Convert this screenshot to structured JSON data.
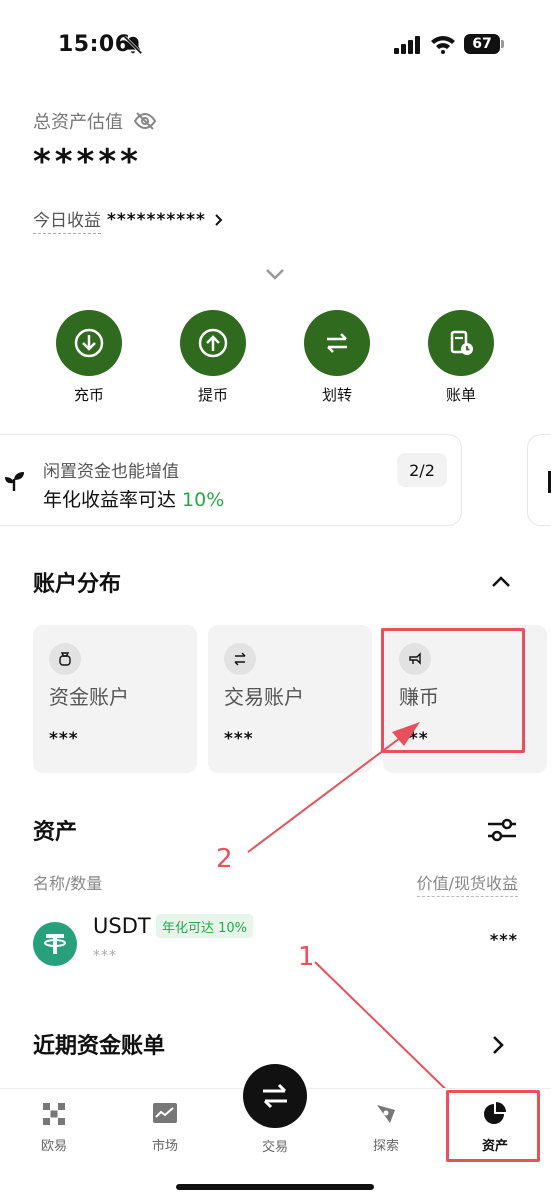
{
  "status_bar": {
    "time": "15:06",
    "battery": "67"
  },
  "summary": {
    "total_label": "总资产估值",
    "total_value": "*****",
    "today_label": "今日收益",
    "today_value": "**********"
  },
  "actions": [
    {
      "label": "充币",
      "icon": "deposit-icon"
    },
    {
      "label": "提币",
      "icon": "withdraw-icon"
    },
    {
      "label": "划转",
      "icon": "transfer-icon"
    },
    {
      "label": "账单",
      "icon": "bill-icon"
    }
  ],
  "promo": {
    "title": "闲置资金也能增值",
    "subtitle_prefix": "年化收益率可达 ",
    "rate": "10%",
    "pager": "2/2"
  },
  "distribution": {
    "title": "账户分布",
    "accounts": [
      {
        "name": "资金账户",
        "value": "***",
        "icon": "bag-icon"
      },
      {
        "name": "交易账户",
        "value": "***",
        "icon": "swap-icon"
      },
      {
        "name": "赚币",
        "value": "***",
        "icon": "earn-icon"
      }
    ]
  },
  "assets": {
    "title": "资产",
    "col_left": "名称/数量",
    "col_right": "价值/现货收益",
    "rows": [
      {
        "name": "USDT",
        "badge": "年化可达 10%",
        "qty": "***",
        "value": "***"
      }
    ]
  },
  "recent": {
    "title": "近期资金账单"
  },
  "annotations": {
    "one": "1",
    "two": "2"
  },
  "tabbar": {
    "items": [
      {
        "label": "欧易",
        "icon": "okx-icon"
      },
      {
        "label": "市场",
        "icon": "market-icon"
      },
      {
        "label": "交易",
        "icon": "trade-icon"
      },
      {
        "label": "探索",
        "icon": "explore-icon"
      },
      {
        "label": "资产",
        "icon": "assets-pie-icon"
      }
    ],
    "active": "资产"
  },
  "colors": {
    "brand_green": "#2f6a1f",
    "positive": "#2aa64b",
    "annotation": "#e8505b"
  }
}
